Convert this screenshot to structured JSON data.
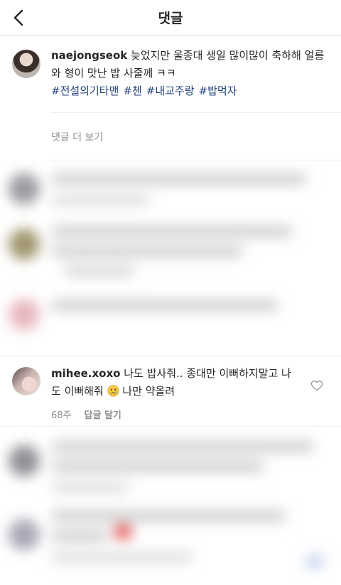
{
  "header": {
    "title": "댓글"
  },
  "caption": {
    "username": "naejongseok",
    "text": "늦었지만 울종대 생일 많이많이 축하해 얼릉와 형이 맛난 밥 사줄께 ㅋㅋ",
    "hashtags": [
      "#전설의기타맨",
      "#첸",
      "#내교주랑",
      "#밥먹자"
    ]
  },
  "more_comments": "댓글 더 보기",
  "comment": {
    "username": "mihee.xoxo",
    "text_before_emoji": "나도 밥사줘.. 종대만 이뻐하지말고 나도 이뻐해줘",
    "emoji": "crying-face-icon",
    "text_after_emoji": "나만 약올려",
    "time": "68주",
    "reply_label": "답글 달기"
  },
  "colors": {
    "hashtag": "#1f3f7a",
    "muted": "#8e8e8e",
    "divider": "#dbdbdb"
  }
}
